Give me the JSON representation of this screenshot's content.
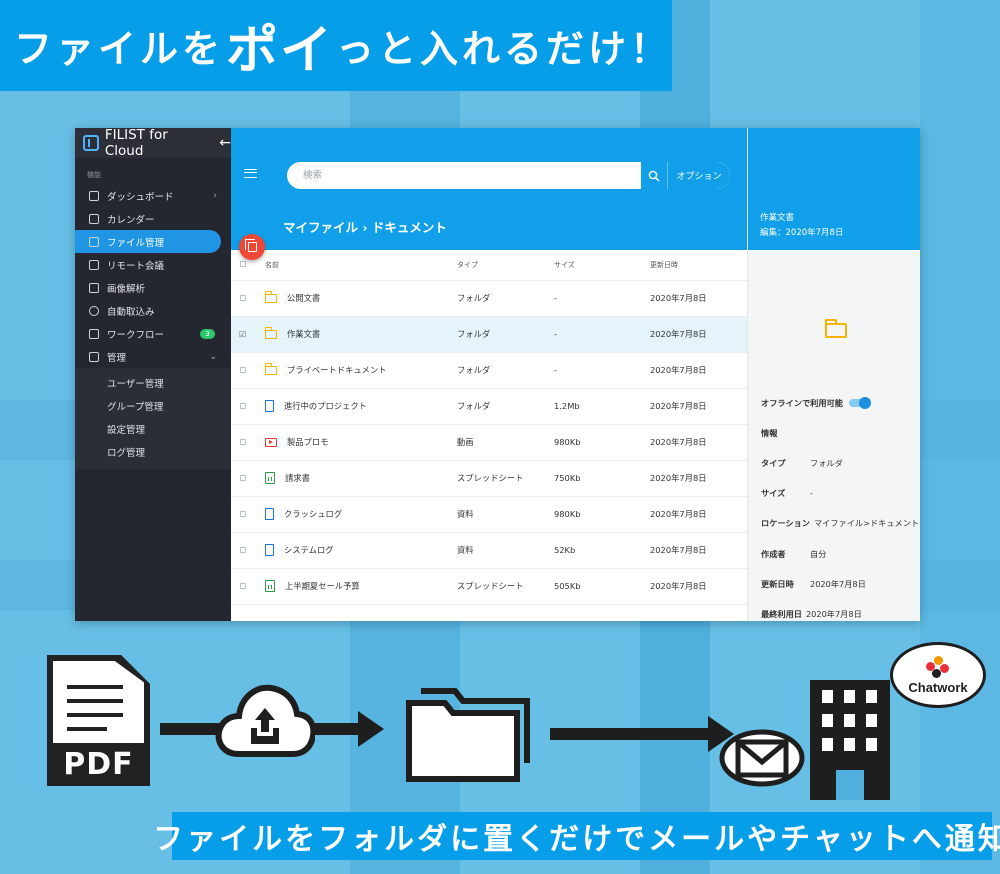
{
  "banner": {
    "headline_pre": "ファイルを",
    "headline_big": "ポイ",
    "headline_post": "っと入れるだけ！"
  },
  "app": {
    "brand": "FILIST for Cloud",
    "section_label": "機能",
    "nav": [
      {
        "label": "ダッシュボード",
        "icon": "dashboard-icon",
        "chevron": "›"
      },
      {
        "label": "カレンダー",
        "icon": "calendar-icon"
      },
      {
        "label": "ファイル管理",
        "icon": "folder-icon",
        "active": true
      },
      {
        "label": "リモート会議",
        "icon": "video-icon"
      },
      {
        "label": "画像解析",
        "icon": "image-scan-icon"
      },
      {
        "label": "自動取込み",
        "icon": "sync-icon"
      },
      {
        "label": "ワークフロー",
        "icon": "workflow-icon",
        "badge": "3"
      },
      {
        "label": "管理",
        "icon": "lock-icon",
        "chevron": "⌄"
      }
    ],
    "admin_sub": [
      "ユーザー管理",
      "グループ管理",
      "設定管理",
      "ログ管理"
    ],
    "search": {
      "placeholder": "検索",
      "option_label": "オプション"
    },
    "path_title": "マイファイル › ドキュメント",
    "columns": {
      "name": "名前",
      "type": "タイプ",
      "size": "サイズ",
      "updated": "更新日時"
    },
    "files": [
      {
        "name": "公開文書",
        "icon": "folder",
        "type": "フォルダ",
        "size": "-",
        "updated": "2020年7月8日",
        "checked": false
      },
      {
        "name": "作業文書",
        "icon": "folder",
        "type": "フォルダ",
        "size": "-",
        "updated": "2020年7月8日",
        "checked": true
      },
      {
        "name": "プライベートドキュメント",
        "icon": "folder",
        "type": "フォルダ",
        "size": "-",
        "updated": "2020年7月8日",
        "checked": false
      },
      {
        "name": "進行中のプロジェクト",
        "icon": "doc",
        "type": "フォルダ",
        "size": "1.2Mb",
        "updated": "2020年7月8日",
        "checked": false
      },
      {
        "name": "製品プロモ",
        "icon": "video",
        "type": "動画",
        "size": "980Kb",
        "updated": "2020年7月8日",
        "checked": false
      },
      {
        "name": "請求書",
        "icon": "sheet",
        "type": "スプレッドシート",
        "size": "750Kb",
        "updated": "2020年7月8日",
        "checked": false
      },
      {
        "name": "クラッシュログ",
        "icon": "doc",
        "type": "資料",
        "size": "980Kb",
        "updated": "2020年7月8日",
        "checked": false
      },
      {
        "name": "システムログ",
        "icon": "doc",
        "type": "資料",
        "size": "52Kb",
        "updated": "2020年7月8日",
        "checked": false
      },
      {
        "name": "上半期夏セール予算",
        "icon": "sheet",
        "type": "スプレッドシート",
        "size": "505Kb",
        "updated": "2020年7月8日",
        "checked": false
      }
    ],
    "detail": {
      "title": "作業文書",
      "edited": "編集：2020年7月8日",
      "offline_label": "オフラインで利用可能",
      "info_label": "情報",
      "props": [
        {
          "k": "タイプ",
          "v": "フォルダ"
        },
        {
          "k": "サイズ",
          "v": "-"
        },
        {
          "k": "ロケーション",
          "v": "マイファイル>ドキュメント"
        },
        {
          "k": "作成者",
          "v": "自分"
        },
        {
          "k": "更新日時",
          "v": "2020年7月8日"
        },
        {
          "k": "最終利用日",
          "v": "2020年7月8日"
        }
      ]
    }
  },
  "workflow": {
    "pdf_label": "PDF",
    "chatwork_label": "Chatwork",
    "notice": "ファイルをフォルダに置くだけでメールやチャットへ通知"
  },
  "colors": {
    "accent": "#069ee8",
    "sidebar": "#24272f",
    "active": "#1f95e3",
    "fab": "#ef4836"
  }
}
